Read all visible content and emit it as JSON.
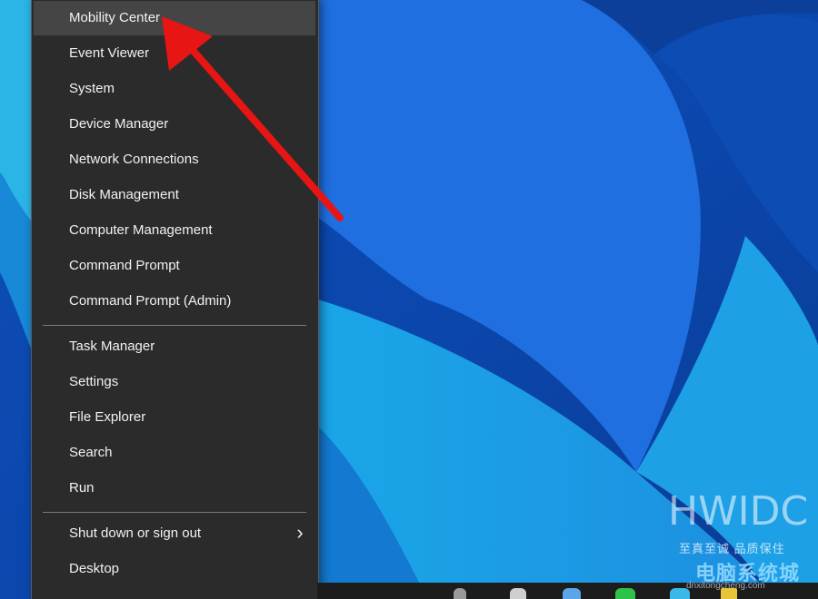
{
  "menu": {
    "groups": [
      [
        "Mobility Center",
        "Event Viewer",
        "System",
        "Device Manager",
        "Network Connections",
        "Disk Management",
        "Computer Management",
        "Command Prompt",
        "Command Prompt (Admin)"
      ],
      [
        "Task Manager",
        "Settings",
        "File Explorer",
        "Search",
        "Run"
      ],
      [
        "Shut down or sign out",
        "Desktop"
      ]
    ],
    "highlighted_item": "Mobility Center",
    "submenu_item": "Shut down or sign out",
    "submenu_glyph": "›"
  },
  "annotation": {
    "type": "arrow",
    "color": "#e81515",
    "points_to": "Mobility Center"
  },
  "watermark": {
    "logo": "HWIDC",
    "slogan": "至真至诚 品质保住",
    "brand": "电脑系统城",
    "url": "dnxitongcheng.com"
  },
  "colors": {
    "menu_bg": "#2b2b2b",
    "menu_hover": "#454545",
    "menu_text": "#f2f2f2",
    "separator": "#7a7a7a",
    "taskbar": "#1c1c1c"
  }
}
